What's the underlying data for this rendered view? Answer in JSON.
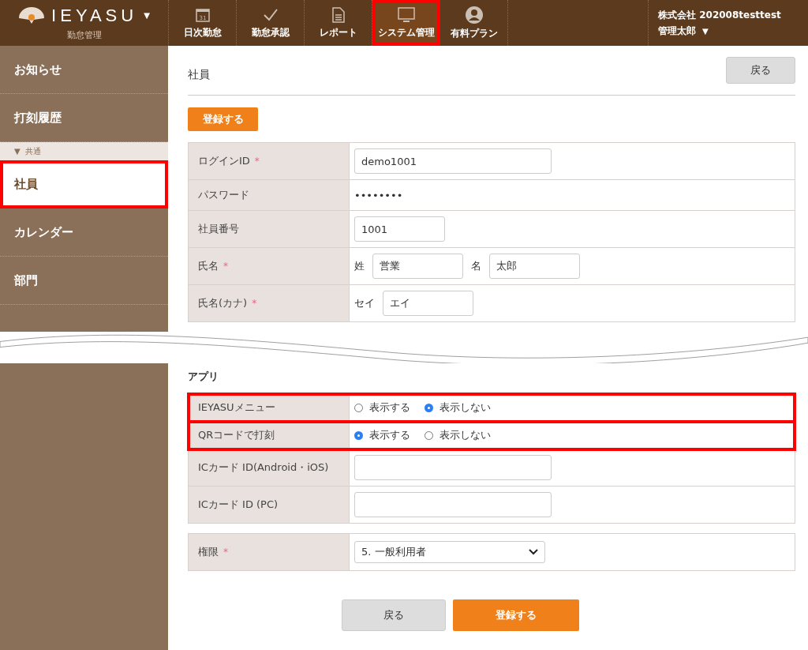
{
  "header": {
    "logo": "IEYASU",
    "logo_caret": "▼",
    "subtitle": "勤怠管理",
    "nav": [
      {
        "label": "日次勤怠",
        "calendar_day": "31",
        "highlighted": false
      },
      {
        "label": "勤怠承認",
        "highlighted": false
      },
      {
        "label": "レポート",
        "highlighted": false
      },
      {
        "label": "システム管理",
        "highlighted": true
      },
      {
        "label": "有料プラン",
        "highlighted": false
      }
    ],
    "company": "株式会社 202008testtest",
    "user": "管理太郎",
    "user_caret": "▼"
  },
  "sidebar": {
    "items": [
      {
        "kind": "item",
        "label": "お知らせ",
        "selected": false,
        "highlighted": false
      },
      {
        "kind": "item",
        "label": "打刻履歴",
        "selected": false,
        "highlighted": false
      },
      {
        "kind": "group",
        "label": "共通",
        "marker": "▼"
      },
      {
        "kind": "item",
        "label": "社員",
        "selected": true,
        "highlighted": true
      },
      {
        "kind": "item",
        "label": "カレンダー",
        "selected": false,
        "highlighted": false
      },
      {
        "kind": "item",
        "label": "部門",
        "selected": false,
        "highlighted": false
      }
    ]
  },
  "page": {
    "title": "社員",
    "back_button": "戻る",
    "register_button": "登録する"
  },
  "form": {
    "rows": [
      {
        "kind": "text",
        "label": "ログインID",
        "mark": "*",
        "value": "demo1001"
      },
      {
        "kind": "static",
        "label": "パスワード",
        "value": "••••••••"
      },
      {
        "kind": "short",
        "label": "社員番号",
        "value": "1001"
      },
      {
        "kind": "name",
        "label": "氏名",
        "mark": "*",
        "parts": [
          {
            "label": "姓",
            "value": "営業"
          },
          {
            "label": "名",
            "value": "太郎"
          }
        ]
      },
      {
        "kind": "name",
        "label": "氏名(カナ)",
        "mark": "*",
        "parts": [
          {
            "label": "セイ",
            "value": "エイ"
          }
        ]
      }
    ]
  },
  "app_section": {
    "title": "アプリ",
    "rows": [
      {
        "kind": "radio",
        "label": "IEYASUメニュー",
        "highlighted": true,
        "options": [
          {
            "label": "表示する",
            "selected": false
          },
          {
            "label": "表示しない",
            "selected": true
          }
        ]
      },
      {
        "kind": "radio",
        "label": "QRコードで打刻",
        "highlighted": true,
        "options": [
          {
            "label": "表示する",
            "selected": true
          },
          {
            "label": "表示しない",
            "selected": false
          }
        ]
      },
      {
        "kind": "text",
        "label": "ICカード ID(Android・iOS)",
        "highlighted": false
      },
      {
        "kind": "text",
        "label": "ICカード ID (PC)",
        "highlighted": false
      }
    ]
  },
  "role": {
    "label": "権限",
    "mark": "*",
    "value": "5. 一般利用者"
  },
  "footer_buttons": {
    "back": "戻る",
    "submit": "登録する"
  }
}
